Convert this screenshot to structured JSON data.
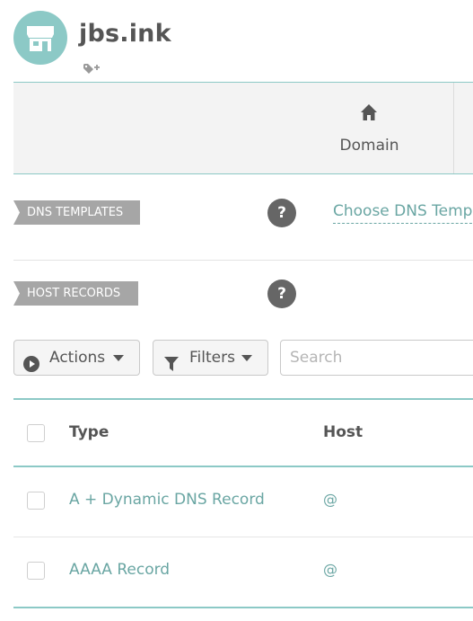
{
  "header": {
    "title": "jbs.ink",
    "logo_icon": "storefront-icon",
    "tag_icon": "tag-add-icon"
  },
  "tabs": [
    {
      "label": "",
      "icon": ""
    },
    {
      "label": "Domain",
      "icon": "home-icon"
    }
  ],
  "dns_templates": {
    "ribbon_label": "DNS TEMPLATES",
    "help_label": "?",
    "select_text": "Choose DNS Templ"
  },
  "host_records": {
    "ribbon_label": "HOST RECORDS",
    "help_label": "?"
  },
  "toolbar": {
    "actions_label": "Actions",
    "filters_label": "Filters",
    "search_placeholder": "Search"
  },
  "table": {
    "columns": [
      "Type",
      "Host"
    ],
    "rows": [
      {
        "type": "A + Dynamic DNS Record",
        "host": "@"
      },
      {
        "type": "AAAA Record",
        "host": "@"
      }
    ]
  },
  "colors": {
    "accent_teal": "#8cc9c6",
    "link_teal": "#6aa6a3",
    "ribbon_gray": "#a6a6a6",
    "help_dark": "#666666"
  }
}
